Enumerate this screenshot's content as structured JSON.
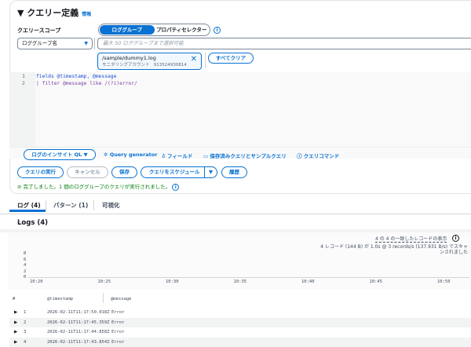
{
  "header": {
    "title": "クエリー定義",
    "info": "情報"
  },
  "scope": {
    "label": "クエリースコープ",
    "seg": [
      "ロググループ",
      "プロパティセレクター"
    ],
    "dropdown": "ロググループ名",
    "placeholder": "最大 50 ロググループまで選択可能",
    "token_name": "/sample/dummy1.log",
    "token_sub": "モニタリングアカウント",
    "token_id": "913524930814",
    "clear": "すべてクリア"
  },
  "editor": {
    "lines": [
      {
        "n": "1",
        "code": "fields @timestamp, @message"
      },
      {
        "n": "2",
        "code": "| filter @message like /(?i)error/"
      }
    ]
  },
  "toolbar": {
    "ql": "ログのインサイト QL",
    "gen": "Query generator",
    "fields": "フィールド",
    "saved": "保存済みクエリとサンプルクエリ",
    "cmds": "クエリコマンド"
  },
  "actions": {
    "run": "クエリの実行",
    "cancel": "キャンセル",
    "save": "保存",
    "schedule": "クエリをスケジュール",
    "history": "履歴"
  },
  "status": "完了しました。1 個のロググループのクエリが実行されました。",
  "tabs": [
    "ログ (4)",
    "パターン (1)",
    "可視化"
  ],
  "logs": {
    "title": "Logs (4)",
    "shown": "4 の 4 の一致したレコードの表示",
    "scan": "4 レコード (144 B) が 1.0s @ 3 records/s (137.931 B/s) でスキャンされました"
  },
  "chart_data": {
    "type": "bar",
    "yticks": [
      "8",
      "6",
      "4",
      "2",
      "0"
    ],
    "xticks": [
      "10:20",
      "10:25",
      "10:30",
      "10:35",
      "10:40",
      "10:45",
      "10:50"
    ],
    "ylim": [
      0,
      8
    ]
  },
  "table": {
    "cols": [
      "#",
      "@timestamp",
      "@message"
    ],
    "rows": [
      [
        "1",
        "2026-02-11T11:17:50.018Z",
        "Error"
      ],
      [
        "2",
        "2026-02-11T11:17:45.359Z",
        "Error"
      ],
      [
        "3",
        "2026-02-11T11:17:44.858Z",
        "Error"
      ],
      [
        "4",
        "2026-02-11T11:17:43.854Z",
        "Error"
      ]
    ]
  }
}
